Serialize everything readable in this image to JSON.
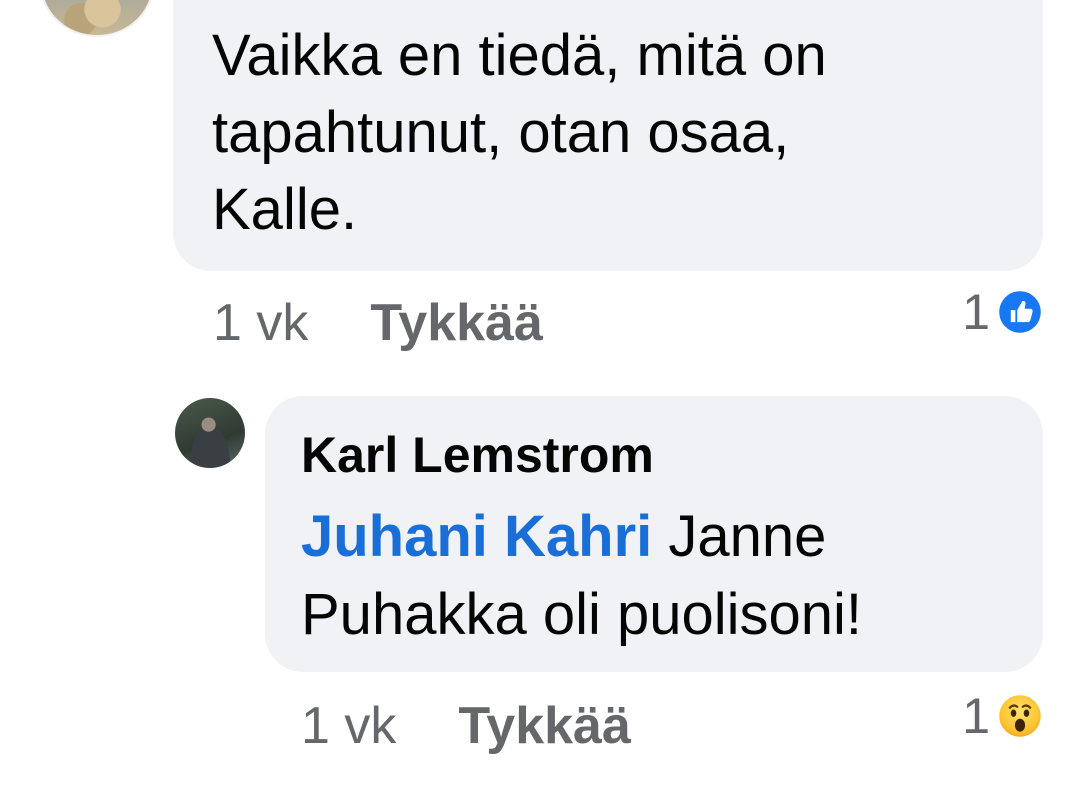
{
  "comment": {
    "text": "Vaikka en tiedä, mitä on\ntapahtunut, otan osaa,\nKalle.",
    "time": "1 vk",
    "like_label": "Tykkää",
    "reaction_count": "1",
    "reaction_icon": "like-reaction-icon"
  },
  "reply": {
    "author": "Karl Lemstrom",
    "mention": "Juhani Kahri",
    "text": " Janne\nPuhakka oli puolisoni!",
    "time": "1 vk",
    "like_label": "Tykkää",
    "reaction_count": "1",
    "reaction_icon": "wow-reaction-icon"
  },
  "colors": {
    "bubble_bg": "#f0f2f5",
    "meta_text": "#65676b",
    "mention": "#1a6ed8",
    "like_blue": "#1877f2"
  }
}
